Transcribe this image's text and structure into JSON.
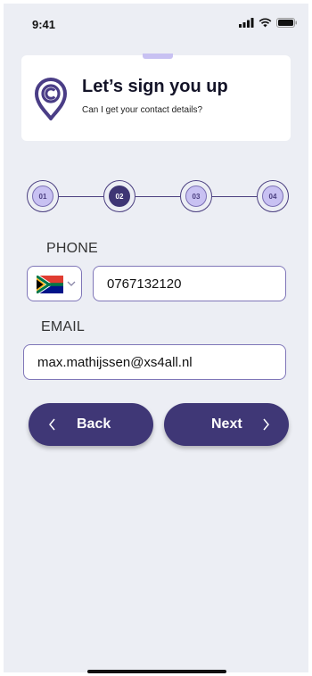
{
  "status_bar": {
    "time": "9:41",
    "icons": [
      "signal-icon",
      "wifi-icon",
      "battery-icon"
    ]
  },
  "header": {
    "title": "Let’s sign you up",
    "subtitle": "Can I get your contact details?",
    "logo": "location-pin-logo"
  },
  "stepper": {
    "steps": [
      "01",
      "02",
      "03",
      "04"
    ],
    "current": "02"
  },
  "phone": {
    "label": "PHONE",
    "country_flag": "south-africa-flag-icon",
    "value": "0767132120"
  },
  "email": {
    "label": "EMAIL",
    "value": "max.mathijssen@xs4all.nl"
  },
  "buttons": {
    "back": "Back",
    "next": "Next"
  },
  "colors": {
    "accent": "#3f3776",
    "accent_light": "#c8c1f2",
    "background": "#eceef4",
    "input_border": "#7f76b8"
  }
}
